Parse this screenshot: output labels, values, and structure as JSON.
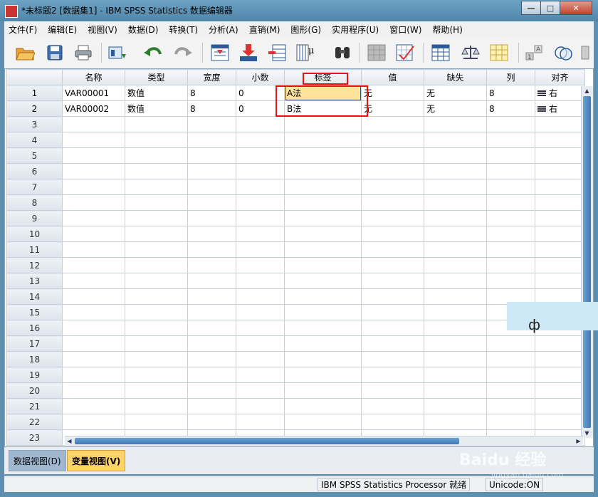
{
  "window": {
    "title": "*未标题2 [数据集1] - IBM SPSS Statistics 数据编辑器",
    "minimize": "—",
    "maximize": "□",
    "close": "✕"
  },
  "menubar": {
    "items": [
      "文件(F)",
      "编辑(E)",
      "视图(V)",
      "数据(D)",
      "转换(T)",
      "分析(A)",
      "直销(M)",
      "图形(G)",
      "实用程序(U)",
      "窗口(W)",
      "帮助(H)"
    ]
  },
  "toolbar": {
    "icons": [
      "open-folder-icon",
      "save-icon",
      "print-icon",
      "recall-dialog-icon",
      "undo-icon",
      "redo-icon",
      "goto-case-icon",
      "goto-variable-icon",
      "insert-cases-icon",
      "variables-icon",
      "find-icon",
      "split-file-icon",
      "weight-cases-icon",
      "select-cases-icon",
      "value-labels-icon",
      "use-sets-icon",
      "spelling-icon"
    ]
  },
  "grid": {
    "columns": [
      "名称",
      "类型",
      "宽度",
      "小数",
      "标签",
      "值",
      "缺失",
      "列",
      "对齐"
    ],
    "rows": [
      {
        "num": "1",
        "cells": [
          "VAR00001",
          "数值",
          "8",
          "0",
          "A法",
          "无",
          "无",
          "8",
          "右"
        ]
      },
      {
        "num": "2",
        "cells": [
          "VAR00002",
          "数值",
          "8",
          "0",
          "B法",
          "无",
          "无",
          "8",
          "右"
        ]
      }
    ],
    "empty_rows": [
      "3",
      "4",
      "5",
      "6",
      "7",
      "8",
      "9",
      "10",
      "11",
      "12",
      "13",
      "14",
      "15",
      "16",
      "17",
      "18",
      "19",
      "20",
      "21",
      "22",
      "23"
    ]
  },
  "tabs": {
    "data_view": "数据视图(D)",
    "variable_view": "变量视图(V)"
  },
  "status": {
    "processor": "IBM SPSS Statistics Processor 就绪",
    "unicode": "Unicode:ON"
  },
  "overlay": {
    "float_glyph": "ф",
    "watermark": "Baidu 经验",
    "watermark_url": "jingyan.baidu.com"
  }
}
